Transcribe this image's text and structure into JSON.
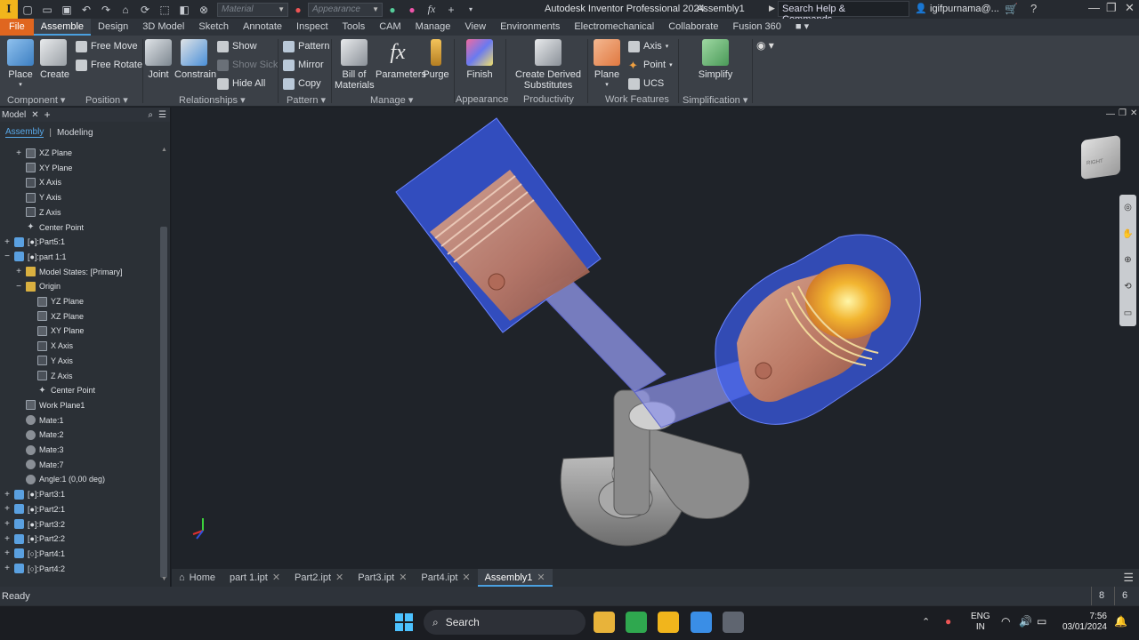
{
  "titlebar": {
    "app_title": "Autodesk Inventor Professional 2024",
    "doc_title": "Assembly1",
    "material_placeholder": "Material",
    "appearance_placeholder": "Appearance",
    "search_text": "Search Help & Commands...",
    "user": "igifpurnama@...",
    "logo": "I"
  },
  "menu": [
    "File",
    "Assemble",
    "Design",
    "3D Model",
    "Sketch",
    "Annotate",
    "Inspect",
    "Tools",
    "CAM",
    "Manage",
    "View",
    "Environments",
    "Electromechanical",
    "Collaborate",
    "Fusion 360"
  ],
  "ribbon": {
    "place": "Place",
    "create": "Create",
    "free_move": "Free Move",
    "free_rotate": "Free Rotate",
    "joint": "Joint",
    "constrain": "Constrain",
    "show": "Show",
    "show_sick": "Show Sick",
    "hide_all": "Hide All",
    "pattern": "Pattern",
    "mirror": "Mirror",
    "copy": "Copy",
    "bom_1": "Bill of",
    "bom_2": "Materials",
    "parameters": "Parameters",
    "purge": "Purge",
    "finish": "Finish",
    "derived_1": "Create Derived",
    "derived_2": "Substitutes",
    "plane": "Plane",
    "axis": "Axis",
    "point": "Point",
    "ucs": "UCS",
    "simplify": "Simplify",
    "panels": {
      "component": "Component",
      "position": "Position",
      "relationships": "Relationships",
      "pattern": "Pattern",
      "manage": "Manage",
      "appearance": "Appearance",
      "productivity": "Productivity",
      "work_features": "Work Features",
      "simplification": "Simplification"
    }
  },
  "browser": {
    "title": "Model",
    "tab_assembly": "Assembly",
    "tab_modeling": "Modeling",
    "tree": [
      {
        "label": "XZ Plane",
        "indent": 1,
        "icon": "plane",
        "tog": "+"
      },
      {
        "label": "XY Plane",
        "indent": 1,
        "icon": "plane",
        "tog": ""
      },
      {
        "label": "X Axis",
        "indent": 1,
        "icon": "axis",
        "tog": ""
      },
      {
        "label": "Y Axis",
        "indent": 1,
        "icon": "axis",
        "tog": ""
      },
      {
        "label": "Z Axis",
        "indent": 1,
        "icon": "axis",
        "tog": ""
      },
      {
        "label": "Center Point",
        "indent": 1,
        "icon": "pt",
        "tog": ""
      },
      {
        "label": "[●]:Part5:1",
        "indent": 0,
        "icon": "part",
        "tog": "+"
      },
      {
        "label": "[●]:part 1:1",
        "indent": 0,
        "icon": "part",
        "tog": "−"
      },
      {
        "label": "Model States: [Primary]",
        "indent": 1,
        "icon": "folder",
        "tog": "+"
      },
      {
        "label": "Origin",
        "indent": 1,
        "icon": "folder",
        "tog": "−"
      },
      {
        "label": "YZ Plane",
        "indent": 2,
        "icon": "plane",
        "tog": ""
      },
      {
        "label": "XZ Plane",
        "indent": 2,
        "icon": "plane",
        "tog": ""
      },
      {
        "label": "XY Plane",
        "indent": 2,
        "icon": "plane",
        "tog": ""
      },
      {
        "label": "X Axis",
        "indent": 2,
        "icon": "axis",
        "tog": ""
      },
      {
        "label": "Y Axis",
        "indent": 2,
        "icon": "axis",
        "tog": ""
      },
      {
        "label": "Z Axis",
        "indent": 2,
        "icon": "axis",
        "tog": ""
      },
      {
        "label": "Center Point",
        "indent": 2,
        "icon": "pt",
        "tog": ""
      },
      {
        "label": "Work Plane1",
        "indent": 1,
        "icon": "plane",
        "tog": ""
      },
      {
        "label": "Mate:1",
        "indent": 1,
        "icon": "mate",
        "tog": ""
      },
      {
        "label": "Mate:2",
        "indent": 1,
        "icon": "mate",
        "tog": ""
      },
      {
        "label": "Mate:3",
        "indent": 1,
        "icon": "mate",
        "tog": ""
      },
      {
        "label": "Mate:7",
        "indent": 1,
        "icon": "mate",
        "tog": ""
      },
      {
        "label": "Angle:1 (0,00 deg)",
        "indent": 1,
        "icon": "mate",
        "tog": ""
      },
      {
        "label": "[●]:Part3:1",
        "indent": 0,
        "icon": "part",
        "tog": "+"
      },
      {
        "label": "[●]:Part2:1",
        "indent": 0,
        "icon": "part",
        "tog": "+"
      },
      {
        "label": "[●]:Part3:2",
        "indent": 0,
        "icon": "part",
        "tog": "+"
      },
      {
        "label": "[●]:Part2:2",
        "indent": 0,
        "icon": "part",
        "tog": "+"
      },
      {
        "label": "[○]:Part4:1",
        "indent": 0,
        "icon": "part",
        "tog": "+"
      },
      {
        "label": "[○]:Part4:2",
        "indent": 0,
        "icon": "part",
        "tog": "+"
      }
    ]
  },
  "viewcube": {
    "right": "RIGHT"
  },
  "doc_tabs": {
    "home": "Home",
    "tabs": [
      "part 1.ipt",
      "Part2.ipt",
      "Part3.ipt",
      "Part4.ipt",
      "Assembly1"
    ]
  },
  "status": {
    "text": "Ready",
    "n1": "8",
    "n2": "6"
  },
  "taskbar": {
    "search": "Search",
    "lang_1": "ENG",
    "lang_2": "IN",
    "time": "7:56",
    "date": "03/01/2024"
  },
  "colors": {
    "file_tab": "#e0661f",
    "accent": "#4aa0e0",
    "piston": "#c98e78",
    "cylinder": "#3a5cf0",
    "crank": "#9a9a9a"
  }
}
